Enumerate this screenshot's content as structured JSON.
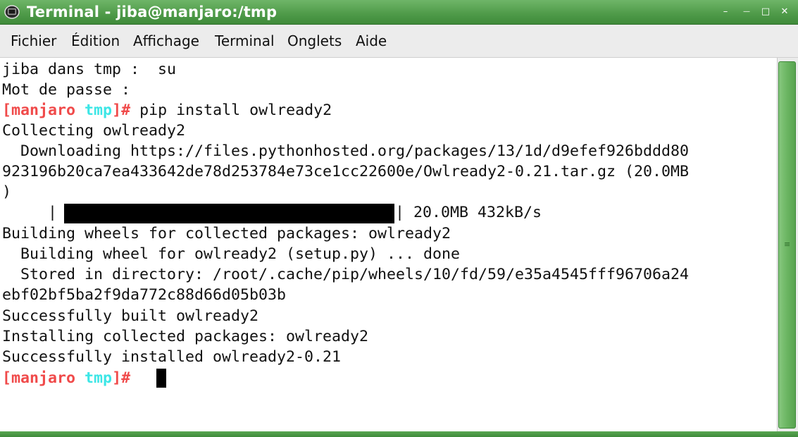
{
  "window": {
    "title": "Terminal - jiba@manjaro:/tmp",
    "controls": {
      "menu": "–",
      "minimize": "—",
      "maximize": "□",
      "close": "✕"
    }
  },
  "menubar": {
    "items": [
      "Fichier",
      "Édition",
      "Affichage",
      "Terminal",
      "Onglets",
      "Aide"
    ]
  },
  "terminal": {
    "prompt": {
      "open": "[",
      "host": "manjaro",
      "dir": "tmp",
      "close": "]#"
    },
    "lines": {
      "l1": "jiba dans tmp :  su",
      "l2": "Mot de passe :",
      "l3_cmd": " pip install owlready2",
      "l4": "Collecting owlready2",
      "l5": "  Downloading https://files.pythonhosted.org/packages/13/1d/d9efef926bddd80",
      "l6": "923196b20ca7ea433642de78d253784e73ce1cc22600e/Owlready2-0.21.tar.gz (20.0MB",
      "l7": ")",
      "l8_left": "     |",
      "l8_right": "| 20.0MB 432kB/s",
      "l9": "Building wheels for collected packages: owlready2",
      "l10": "  Building wheel for owlready2 (setup.py) ... done",
      "l11": "  Stored in directory: /root/.cache/pip/wheels/10/fd/59/e35a4545fff96706a24",
      "l12": "ebf02bf5ba2f9da772c88d66d05b03b",
      "l13": "Successfully built owlready2",
      "l14": "Installing collected packages: owlready2",
      "l15": "Successfully installed owlready2-0.21"
    },
    "download_progress": 1.0
  },
  "colors": {
    "titlebar": "#4e9a48",
    "prompt_host": "#f04a4a",
    "prompt_dir": "#3ce6e6"
  },
  "icons": {
    "app": "terminal-icon"
  }
}
